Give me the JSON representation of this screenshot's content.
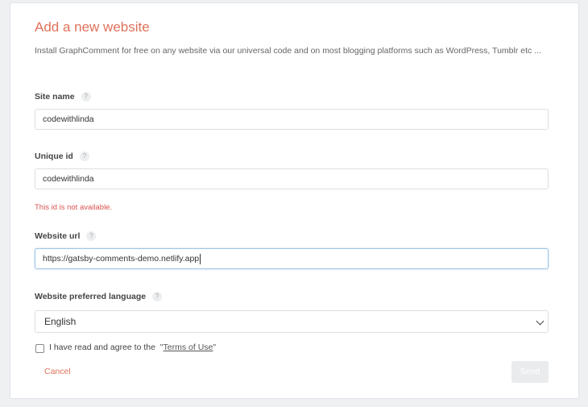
{
  "form": {
    "title": "Add a new website",
    "subtitle": "Install GraphComment for free on any website via our universal code and on most blogging platforms such as WordPress, Tumblr etc ...",
    "help_glyph": "?",
    "site_name": {
      "label": "Site name",
      "value": "codewithlinda"
    },
    "unique_id": {
      "label": "Unique id",
      "value": "codewithlinda",
      "error": "This id is not available."
    },
    "website_url": {
      "label": "Website url",
      "value": "https://gatsby-comments-demo.netlify.app"
    },
    "language": {
      "label": "Website preferred language",
      "selected": "English"
    },
    "agree_text": "I have read and agree to the",
    "terms_link": "Terms of Use",
    "cancel_label": "Cancel",
    "send_label": "Send"
  },
  "colors": {
    "accent": "#e0715a",
    "error": "#d9534f",
    "focus_border": "#9ec5e8"
  }
}
